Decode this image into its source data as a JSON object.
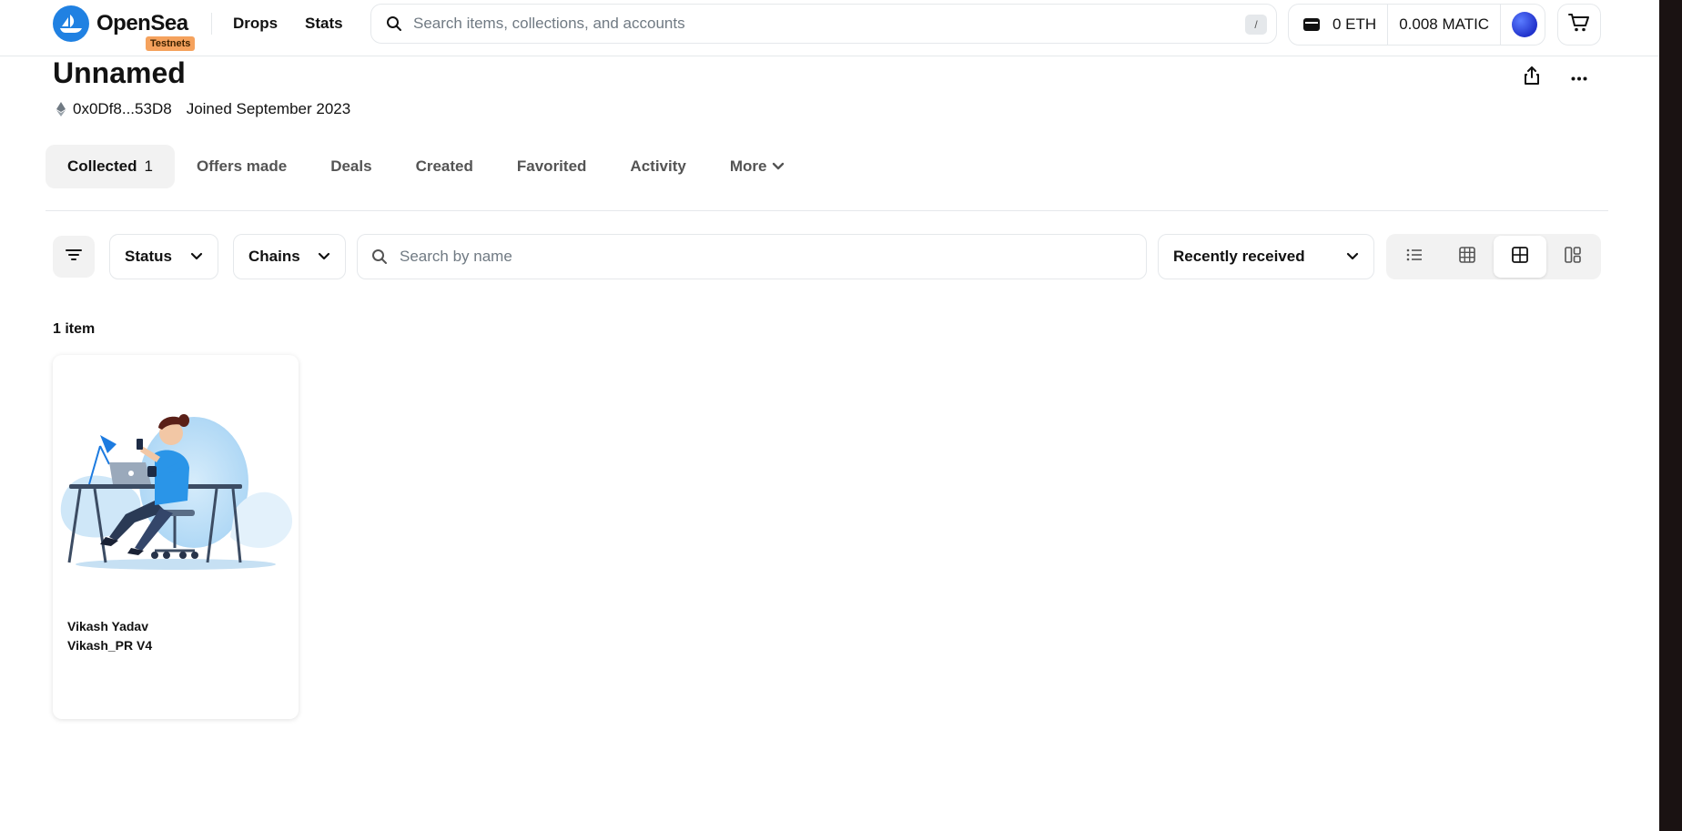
{
  "header": {
    "logo_text": "OpenSea",
    "badge": "Testnets",
    "nav": [
      "Drops",
      "Stats"
    ],
    "search_placeholder": "Search items, collections, and accounts",
    "search_shortcut": "/",
    "eth_balance": "0 ETH",
    "matic_balance": "0.008 MATIC"
  },
  "profile": {
    "name": "Unnamed",
    "address": "0x0Df8...53D8",
    "joined": "Joined September 2023"
  },
  "tabs": [
    {
      "label": "Collected",
      "count": "1"
    },
    {
      "label": "Offers made"
    },
    {
      "label": "Deals"
    },
    {
      "label": "Created"
    },
    {
      "label": "Favorited"
    },
    {
      "label": "Activity"
    },
    {
      "label": "More"
    }
  ],
  "filters": {
    "status_label": "Status",
    "chains_label": "Chains",
    "search_placeholder": "Search by name",
    "sort_label": "Recently received"
  },
  "results": {
    "count_label": "1 item"
  },
  "items": [
    {
      "collection": "Vikash Yadav",
      "name": "Vikash_PR V4"
    }
  ],
  "colors": {
    "brand": "#2081e2",
    "testnets_badge": "#f5a25d",
    "border": "#e5e8eb",
    "muted_text": "#707a83"
  }
}
